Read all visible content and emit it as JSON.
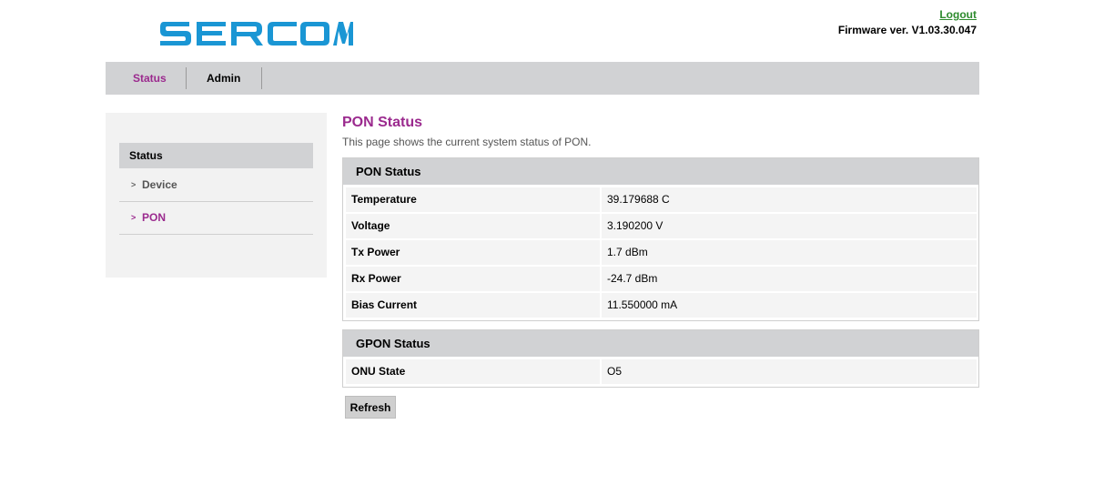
{
  "header": {
    "logout_label": "Logout",
    "firmware": "Firmware ver. V1.03.30.047",
    "brand_color": "#1a96d4"
  },
  "topnav": {
    "tabs": [
      {
        "label": "Status",
        "active": true
      },
      {
        "label": "Admin",
        "active": false
      }
    ]
  },
  "sidebar": {
    "section": "Status",
    "items": [
      {
        "label": "Device",
        "active": false
      },
      {
        "label": "PON",
        "active": true
      }
    ]
  },
  "main": {
    "title": "PON Status",
    "description": "This page shows the current system status of PON.",
    "pon_panel": {
      "heading": "PON Status",
      "rows": [
        {
          "key": "Temperature",
          "value": "39.179688 C"
        },
        {
          "key": "Voltage",
          "value": "3.190200 V"
        },
        {
          "key": "Tx Power",
          "value": "1.7 dBm"
        },
        {
          "key": "Rx Power",
          "value": "-24.7 dBm"
        },
        {
          "key": "Bias Current",
          "value": "11.550000 mA"
        }
      ]
    },
    "gpon_panel": {
      "heading": "GPON Status",
      "rows": [
        {
          "key": "ONU State",
          "value": "O5"
        }
      ]
    },
    "refresh_label": "Refresh"
  },
  "colors": {
    "accent": "#9b2a8e",
    "nav_bg": "#d1d2d4",
    "link_green": "#2e8b2e"
  }
}
